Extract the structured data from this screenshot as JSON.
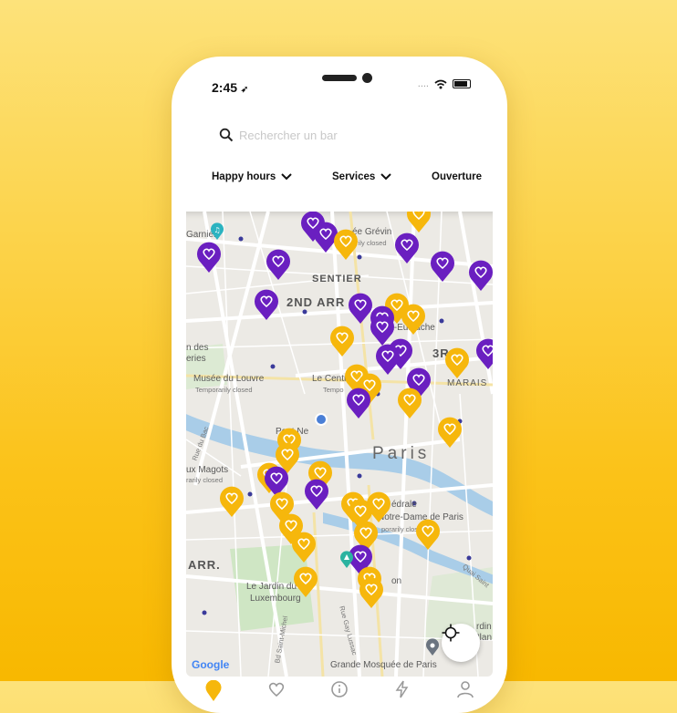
{
  "status_bar": {
    "time": "2:45"
  },
  "search": {
    "placeholder": "Rechercher un bar"
  },
  "filters": [
    {
      "label": "Happy hours",
      "dropdown": true
    },
    {
      "label": "Services",
      "dropdown": true
    },
    {
      "label": "Ouverture",
      "dropdown": false
    }
  ],
  "map": {
    "labels": {
      "garnier": "Garnier",
      "grevin": "ée Grévin",
      "grevin_sub": "arily closed",
      "sentier": "SENTIER",
      "arr2": "2ND ARR",
      "eustache": "Saint-Eustache",
      "arr3": "3R",
      "jardin_des": "n des",
      "jardin_des2": "eries",
      "louvre": "Musée du Louvre",
      "louvre_sub": "Temporarily closed",
      "centre": "Le Centre",
      "centre_sub": "Tempo",
      "marais": "MARAIS",
      "pont_neuf": "Pont Ne",
      "paris": "Paris",
      "magots": "ux Magots",
      "magots_sub": "rarily closed",
      "cathedrale": "édrale",
      "notre_dame": "Notre-Dame de Paris",
      "nd_sub": "porarily close",
      "arr_left": "ARR.",
      "jardin_lux": "Le Jardin du",
      "jardin_lux2": "Luxembourg",
      "mosquee": "Grande Mosquée de Paris",
      "on": "on",
      "jardin_right": "rdin",
      "plan": "Plan",
      "quai": "Quai Saint",
      "rue": "Rue Gay Lussac",
      "bd": "Bd Saint-Michel",
      "rue_bac": "Rue du Bac"
    },
    "google_logo": "Google"
  },
  "colors": {
    "purple": "#6a1fc0",
    "yellow": "#f6b70c",
    "water": "#a9cde8",
    "park": "#cfe6c4"
  },
  "tabs": [
    {
      "icon": "map-pin-icon",
      "active": true
    },
    {
      "icon": "heart-icon",
      "active": false
    },
    {
      "icon": "info-icon",
      "active": false
    },
    {
      "icon": "bolt-icon",
      "active": false
    },
    {
      "icon": "user-icon",
      "active": false
    }
  ]
}
